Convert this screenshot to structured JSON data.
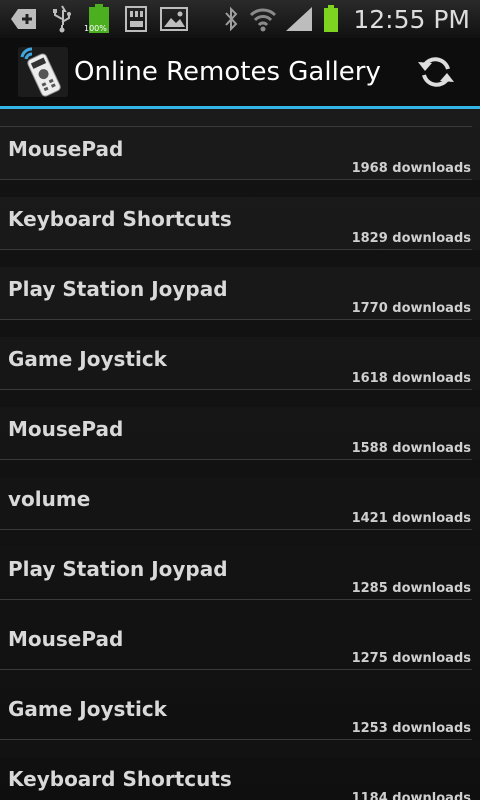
{
  "status_bar": {
    "battery_percent_label": "100%",
    "time": "12:55 PM",
    "icons": [
      "add-notification-icon",
      "usb-icon",
      "battery-full-icon",
      "sd-card-icon",
      "gallery-icon",
      "bluetooth-icon",
      "wifi-icon",
      "signal-icon",
      "battery-icon"
    ],
    "battery_color": "#4caf20"
  },
  "action_bar": {
    "title": "Online Remotes Gallery",
    "accent_color": "#33b5e5",
    "refresh_icon": "refresh-icon"
  },
  "remotes": [
    {
      "name": "MousePad",
      "downloads": "1968 downloads"
    },
    {
      "name": "Keyboard Shortcuts",
      "downloads": "1829 downloads"
    },
    {
      "name": "Play Station Joypad",
      "downloads": "1770 downloads"
    },
    {
      "name": "Game Joystick",
      "downloads": "1618 downloads"
    },
    {
      "name": "MousePad",
      "downloads": "1588 downloads"
    },
    {
      "name": "volume",
      "downloads": "1421 downloads"
    },
    {
      "name": "Play Station Joypad",
      "downloads": "1285 downloads"
    },
    {
      "name": "MousePad",
      "downloads": "1275 downloads"
    },
    {
      "name": "Game Joystick",
      "downloads": "1253 downloads"
    },
    {
      "name": "Keyboard Shortcuts",
      "downloads": "1184 downloads"
    }
  ]
}
